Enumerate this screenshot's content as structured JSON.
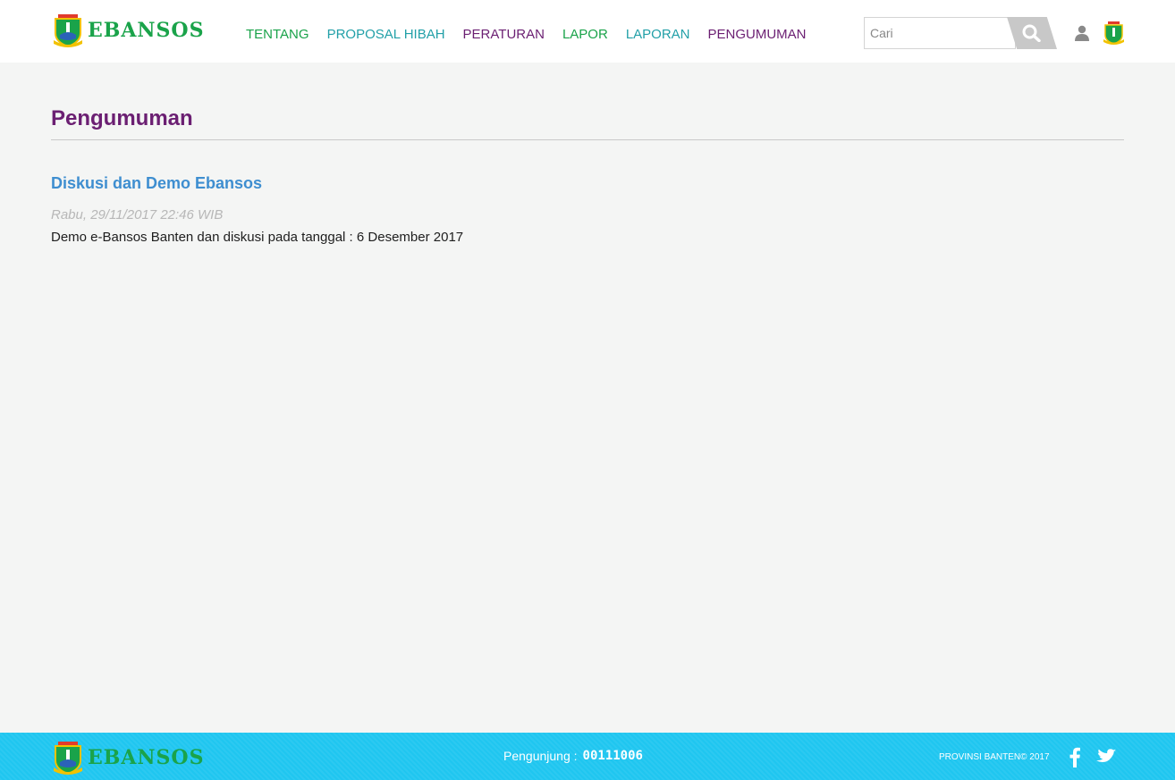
{
  "header": {
    "logo_text": "EBANSOS",
    "nav": [
      {
        "label": "TENTANG",
        "color": "#1aa34a"
      },
      {
        "label": "PROPOSAL HIBAH",
        "color": "#22a0a8"
      },
      {
        "label": "PERATURAN",
        "color": "#6b1f72"
      },
      {
        "label": "LAPOR",
        "color": "#1aa34a"
      },
      {
        "label": "LAPORAN",
        "color": "#22a0a8"
      },
      {
        "label": "PENGUMUMAN",
        "color": "#6b1f72"
      }
    ],
    "search": {
      "placeholder": "Cari",
      "value": ""
    },
    "icons": {
      "search": "search-icon",
      "user": "user-icon",
      "crest": "banten-crest-icon"
    }
  },
  "main": {
    "page_title": "Pengumuman",
    "announcements": [
      {
        "title": "Diskusi dan Demo Ebansos",
        "date": "Rabu, 29/11/2017 22:46 WIB",
        "body": "Demo e-Bansos Banten dan diskusi pada tanggal : 6 Desember 2017"
      }
    ]
  },
  "footer": {
    "logo_text": "EBANSOS",
    "visitors_label": "Pengunjung :",
    "visitors_count": "00111006",
    "copyright": "PROVINSI BANTEN© 2017",
    "icons": {
      "facebook": "facebook-icon",
      "twitter": "twitter-icon"
    }
  },
  "colors": {
    "brand_green": "#1aa34a",
    "brand_purple": "#6b1f72",
    "link_blue": "#3e8ed0",
    "footer_bg": "#1fc6f0"
  }
}
